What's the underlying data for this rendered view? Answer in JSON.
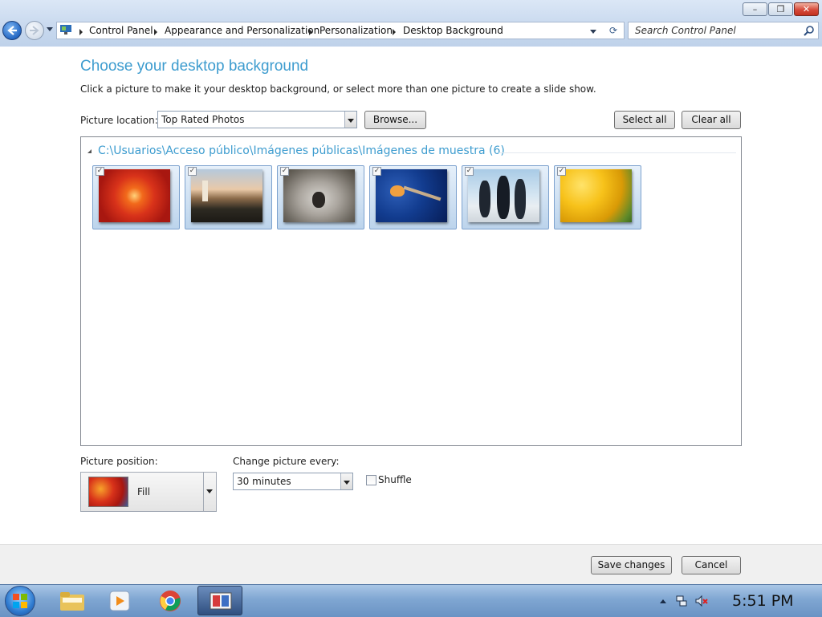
{
  "window": {
    "minimize_glyph": "–",
    "maximize_glyph": "❐",
    "close_glyph": "✕"
  },
  "address": {
    "crumbs": [
      "Control Panel",
      "Appearance and Personalization",
      "Personalization",
      "Desktop Background"
    ],
    "search_placeholder": "Search Control Panel"
  },
  "page": {
    "title": "Choose your desktop background",
    "subtitle": "Click a picture to make it your desktop background, or select more than one picture to create a slide show."
  },
  "location": {
    "label": "Picture location:",
    "selected": "Top Rated Photos",
    "browse_label": "Browse...",
    "select_all_label": "Select all",
    "clear_all_label": "Clear all"
  },
  "gallery": {
    "group_header": "C:\\Usuarios\\Acceso público\\Imágenes públicas\\Imágenes de muestra (6)",
    "pictures": [
      {
        "name": "chrysanthemum-picture",
        "checked": true
      },
      {
        "name": "lighthouse-picture",
        "checked": true
      },
      {
        "name": "koala-picture",
        "checked": true
      },
      {
        "name": "jellyfish-picture",
        "checked": true
      },
      {
        "name": "penguins-picture",
        "checked": true
      },
      {
        "name": "tulips-picture",
        "checked": true
      }
    ]
  },
  "position": {
    "label": "Picture position:",
    "selected": "Fill"
  },
  "interval": {
    "label": "Change picture every:",
    "selected": "30 minutes"
  },
  "shuffle": {
    "label": "Shuffle",
    "checked": false
  },
  "footer": {
    "save_label": "Save changes",
    "cancel_label": "Cancel"
  },
  "taskbar": {
    "clock": "5:51 PM",
    "items": [
      "windows-explorer",
      "media-player",
      "chrome",
      "personalization-window"
    ]
  },
  "colors": {
    "accent_title": "#3d9ccf",
    "thumb_selected": "#bcd4ec"
  }
}
